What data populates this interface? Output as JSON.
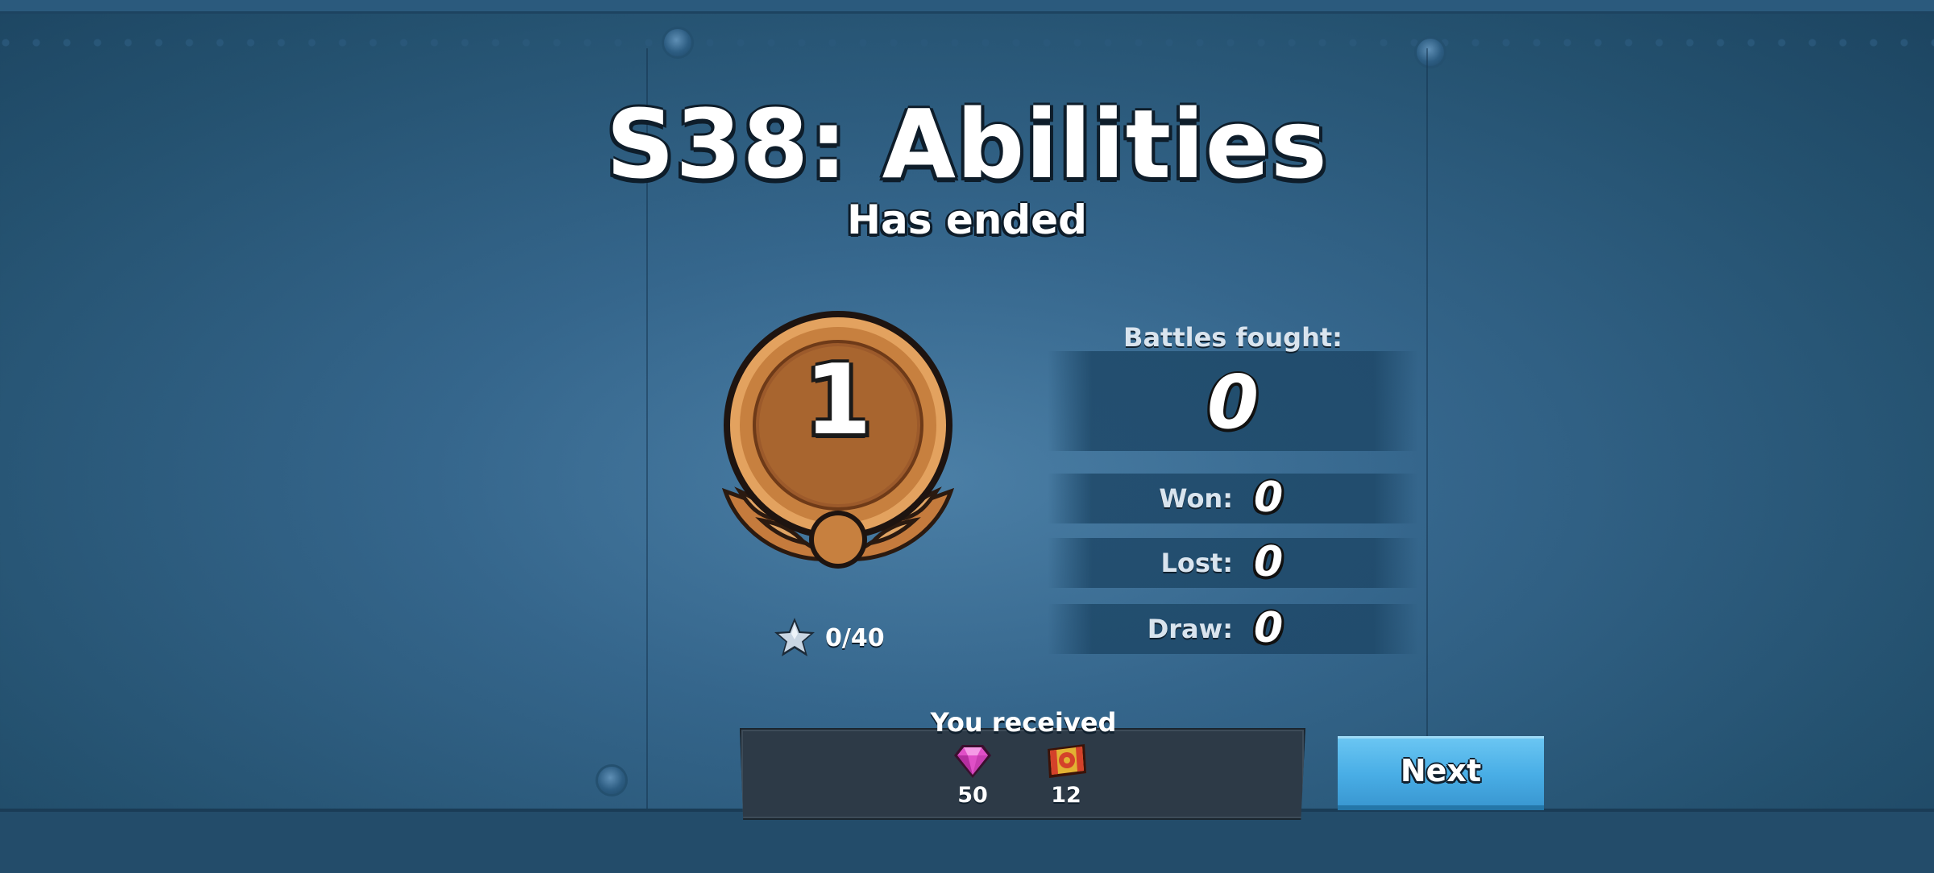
{
  "season": {
    "title": "S38: Abilities",
    "subtitle": "Has ended"
  },
  "medal": {
    "rank_number": "1",
    "color": "#c7803f"
  },
  "stars": {
    "progress_text": "0/40",
    "icon": "star-icon"
  },
  "stats": {
    "battles_label": "Battles fought:",
    "battles_value": "0",
    "won_label": "Won:",
    "won_value": "0",
    "lost_label": "Lost:",
    "lost_value": "0",
    "draw_label": "Draw:",
    "draw_value": "0"
  },
  "rewards": {
    "label": "You received",
    "items": [
      {
        "icon": "gem-icon",
        "amount": "50"
      },
      {
        "icon": "gear-ticket-icon",
        "amount": "12"
      }
    ]
  },
  "actions": {
    "next_label": "Next",
    "next_color": "#49aee6"
  }
}
